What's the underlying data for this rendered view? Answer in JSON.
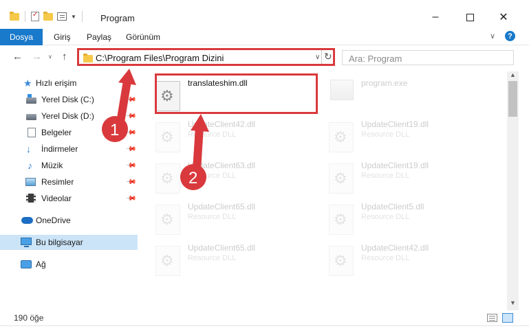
{
  "window": {
    "title": "Program",
    "minimize": "–",
    "maximize": "□",
    "close": "✕"
  },
  "ribbon": {
    "file_tab": "Dosya",
    "tabs": [
      "Giriş",
      "Paylaş",
      "Görünüm"
    ],
    "chevron": "∨",
    "help": "?"
  },
  "nav": {
    "back": "←",
    "forward": "→",
    "recent": "∨",
    "up": "↑",
    "address": "C:\\Program Files\\Program Dizini",
    "address_dropdown": "∨",
    "refresh": "↻",
    "search_placeholder": "Ara: Program"
  },
  "sidebar": {
    "quick_access": "Hızlı erişim",
    "items": [
      {
        "label": "Yerel Disk (C:)",
        "icon": "windows-disk-icon",
        "pinned": true
      },
      {
        "label": "Yerel Disk (D:)",
        "icon": "disk-icon",
        "pinned": true
      },
      {
        "label": "Belgeler",
        "icon": "documents-icon",
        "pinned": true
      },
      {
        "label": "İndirmeler",
        "icon": "downloads-icon",
        "pinned": true
      },
      {
        "label": "Müzik",
        "icon": "music-icon",
        "pinned": true
      },
      {
        "label": "Resimler",
        "icon": "pictures-icon",
        "pinned": true
      },
      {
        "label": "Videolar",
        "icon": "videos-icon",
        "pinned": true
      }
    ],
    "onedrive": "OneDrive",
    "this_pc": "Bu bilgisayar",
    "network": "Ağ"
  },
  "files": [
    {
      "name": "translateshim.dll",
      "type": "",
      "highlighted": true
    },
    {
      "name": "program.exe",
      "type": ""
    },
    {
      "name": "UpdateClient42.dll",
      "type": "Resource DLL"
    },
    {
      "name": "UpdateClient19.dll",
      "type": "Resource DLL"
    },
    {
      "name": "UpdateClient63.dll",
      "type": "Resource DLL"
    },
    {
      "name": "UpdateClient19.dll",
      "type": "Resource DLL"
    },
    {
      "name": "UpdateClient65.dll",
      "type": "Resource DLL"
    },
    {
      "name": "UpdateClient5.dll",
      "type": "Resource DLL"
    },
    {
      "name": "UpdateClient65.dll",
      "type": "Resource DLL"
    },
    {
      "name": "UpdateClient42.dll",
      "type": "Resource DLL"
    }
  ],
  "status": {
    "count": "190 öğe"
  },
  "annotations": {
    "step1": "1",
    "step2": "2",
    "color": "#d9393c"
  },
  "colors": {
    "accent": "#1979ca",
    "selection": "#cce4f7"
  }
}
